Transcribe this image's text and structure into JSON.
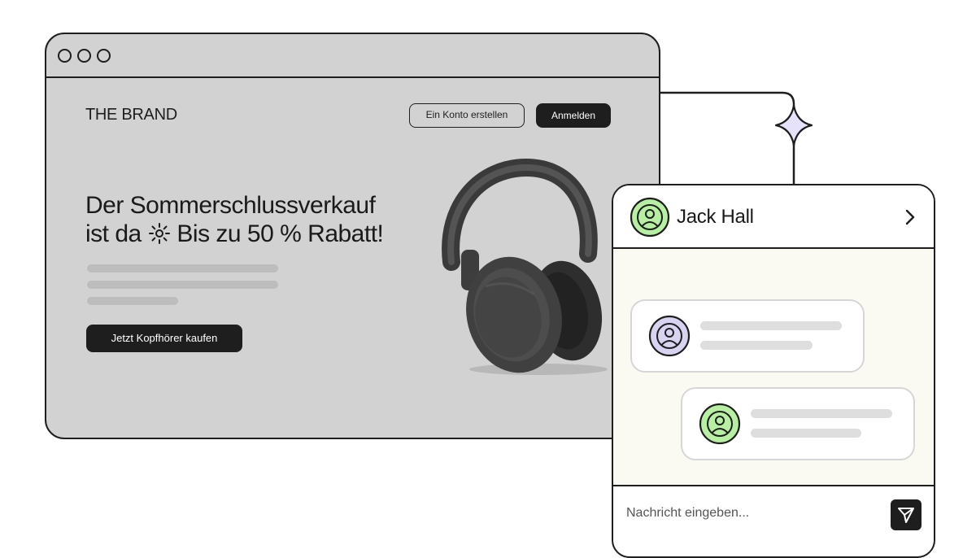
{
  "browser": {
    "window_controls": [
      "circle-icon",
      "circle-icon",
      "circle-icon"
    ],
    "brand": "THE BRAND",
    "nav": {
      "create_account": "Ein Konto erstellen",
      "login": "Anmelden"
    },
    "hero": {
      "headline_line1": "Der Sommerschlussverkauf",
      "headline_line2_a": "ist da",
      "headline_icon": "sun-icon",
      "headline_line2_b": "Bis zu 50 % Rabatt!",
      "cta": "Jetzt Kopfhörer kaufen",
      "image": "headphones-image"
    }
  },
  "chat": {
    "contact_name": "Jack Hall",
    "header_icon": "chevron-right-icon",
    "messages": [
      {
        "sender": "agent",
        "avatar_color": "#d8d3f0"
      },
      {
        "sender": "user",
        "avatar_color": "#b7efa3"
      }
    ],
    "input_placeholder": "Nachricht eingeben...",
    "send_icon": "send-icon"
  },
  "colors": {
    "page_bg": "#d2d2d2",
    "dark": "#1e1e1e",
    "chat_bg": "#fbfaf2",
    "avatar_green": "#b7efa3",
    "avatar_purple": "#d8d3f0",
    "sparkle": "#e6e2fb"
  }
}
